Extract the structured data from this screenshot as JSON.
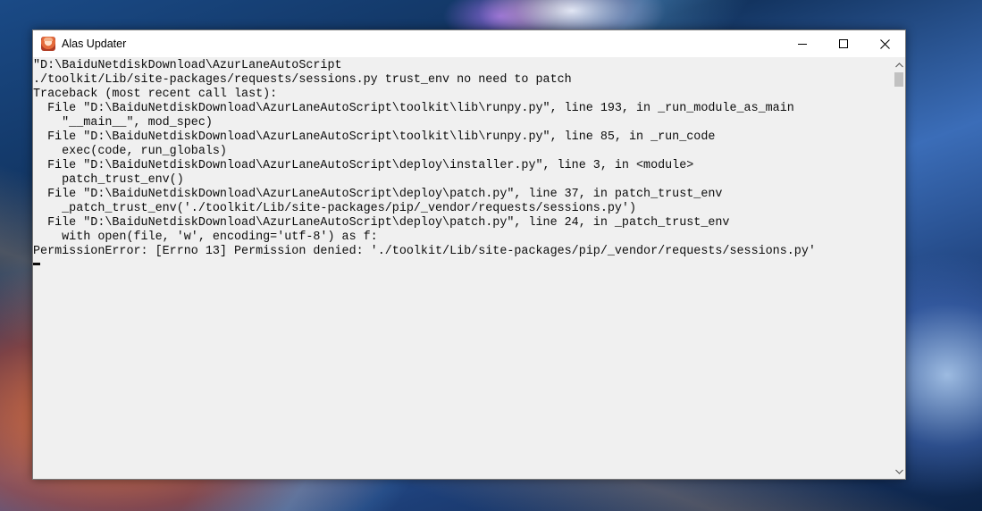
{
  "window": {
    "title": "Alas Updater",
    "icon": "alas-app-icon"
  },
  "controls": {
    "minimize": "minimize-icon",
    "maximize": "maximize-icon",
    "close": "close-icon"
  },
  "console": {
    "lines": [
      "\"D:\\BaiduNetdiskDownload\\AzurLaneAutoScript",
      "./toolkit/Lib/site-packages/requests/sessions.py trust_env no need to patch",
      "Traceback (most recent call last):",
      "  File \"D:\\BaiduNetdiskDownload\\AzurLaneAutoScript\\toolkit\\lib\\runpy.py\", line 193, in _run_module_as_main",
      "    \"__main__\", mod_spec)",
      "  File \"D:\\BaiduNetdiskDownload\\AzurLaneAutoScript\\toolkit\\lib\\runpy.py\", line 85, in _run_code",
      "    exec(code, run_globals)",
      "  File \"D:\\BaiduNetdiskDownload\\AzurLaneAutoScript\\deploy\\installer.py\", line 3, in <module>",
      "    patch_trust_env()",
      "  File \"D:\\BaiduNetdiskDownload\\AzurLaneAutoScript\\deploy\\patch.py\", line 37, in patch_trust_env",
      "    _patch_trust_env('./toolkit/Lib/site-packages/pip/_vendor/requests/sessions.py')",
      "  File \"D:\\BaiduNetdiskDownload\\AzurLaneAutoScript\\deploy\\patch.py\", line 24, in _patch_trust_env",
      "    with open(file, 'w', encoding='utf-8') as f:",
      "PermissionError: [Errno 13] Permission denied: './toolkit/Lib/site-packages/pip/_vendor/requests/sessions.py'"
    ]
  },
  "scrollbar": {
    "up": "chevron-up-icon",
    "down": "chevron-down-icon"
  },
  "colors": {
    "console_bg": "#f0f0f0",
    "console_text": "#0c0c0c",
    "titlebar_bg": "#ffffff"
  }
}
